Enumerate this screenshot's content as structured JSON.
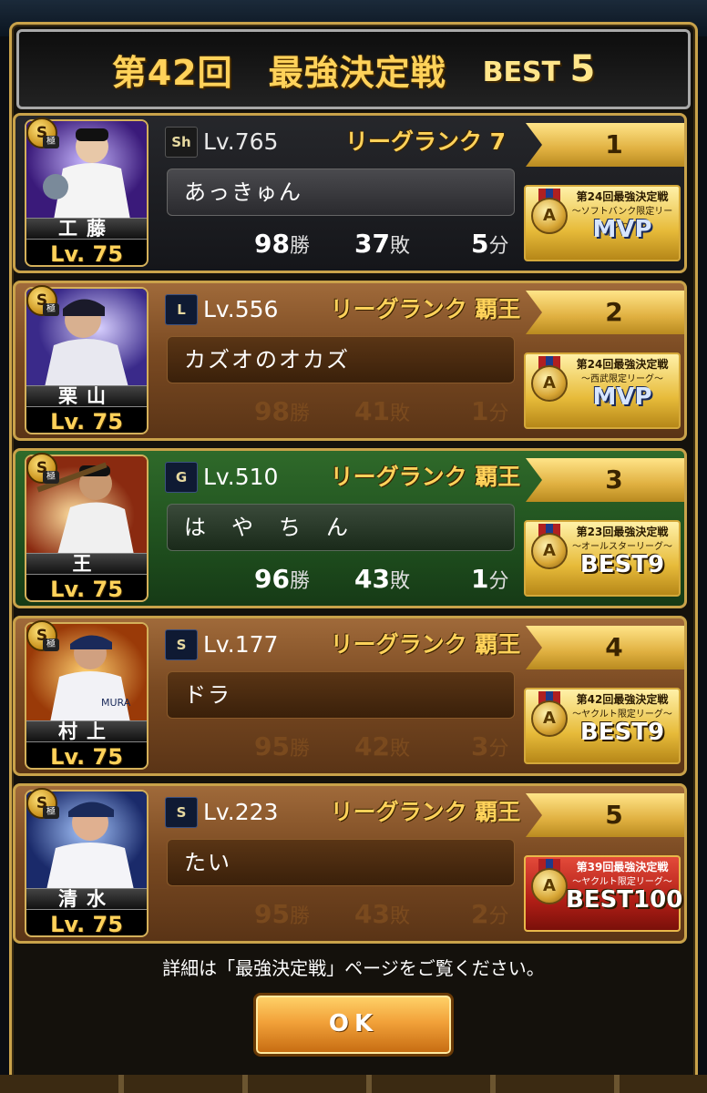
{
  "header": {
    "title": "第42回　最強決定戦",
    "best_label": "BEST",
    "best_num": "5"
  },
  "rows": [
    {
      "badge": "S",
      "badge_sub": "極",
      "player_name": "工藤",
      "player_lv": "Lv. 75",
      "team": "Sh",
      "lv": "Lv.765",
      "rank_text": "リーグランク 7",
      "user_name": "あっきゅん",
      "wins": "98",
      "losses": "37",
      "draws": "5",
      "position": "1",
      "award_line1": "第24回最強決定戦",
      "award_line2": "〜ソフトバンク限定リーグ〜",
      "award_title": "MVP",
      "style": "dark"
    },
    {
      "badge": "S",
      "badge_sub": "極",
      "player_name": "栗山",
      "player_lv": "Lv. 75",
      "team": "L",
      "lv": "Lv.556",
      "rank_text": "リーグランク 覇王",
      "user_name": "カズオのオカズ",
      "wins": "98",
      "losses": "41",
      "draws": "1",
      "position": "2",
      "award_line1": "第24回最強決定戦",
      "award_line2": "〜西武限定リーグ〜",
      "award_title": "MVP",
      "style": "brown"
    },
    {
      "badge": "S",
      "badge_sub": "極",
      "player_name": "王",
      "player_lv": "Lv. 75",
      "team": "G",
      "lv": "Lv.510",
      "rank_text": "リーグランク 覇王",
      "user_name": "は　や　ち　ん",
      "wins": "96",
      "losses": "43",
      "draws": "1",
      "position": "3",
      "award_line1": "第23回最強決定戦",
      "award_line2": "〜オールスターリーグ〜",
      "award_title": "BEST9",
      "style": "green"
    },
    {
      "badge": "S",
      "badge_sub": "極",
      "player_name": "村上",
      "player_lv": "Lv. 75",
      "team": "S",
      "lv": "Lv.177",
      "rank_text": "リーグランク 覇王",
      "user_name": "ドラ",
      "wins": "95",
      "losses": "42",
      "draws": "3",
      "position": "4",
      "award_line1": "第42回最強決定戦",
      "award_line2": "〜ヤクルト限定リーグ〜",
      "award_title": "BEST9",
      "style": "brown"
    },
    {
      "badge": "S",
      "badge_sub": "極",
      "player_name": "清水",
      "player_lv": "Lv. 75",
      "team": "S",
      "lv": "Lv.223",
      "rank_text": "リーグランク 覇王",
      "user_name": "たい",
      "wins": "95",
      "losses": "43",
      "draws": "2",
      "position": "5",
      "award_line1": "第39回最強決定戦",
      "award_line2": "〜ヤクルト限定リーグ〜",
      "award_title": "BEST100",
      "style": "brown"
    }
  ],
  "units": {
    "win": "勝",
    "loss": "敗",
    "draw": "分"
  },
  "footer": {
    "note": "詳細は「最強決定戦」ページをご覧ください。",
    "ok_label": "OK"
  },
  "colors": {
    "gold": "#c9a24a",
    "title_gold": "#ffd25a"
  }
}
